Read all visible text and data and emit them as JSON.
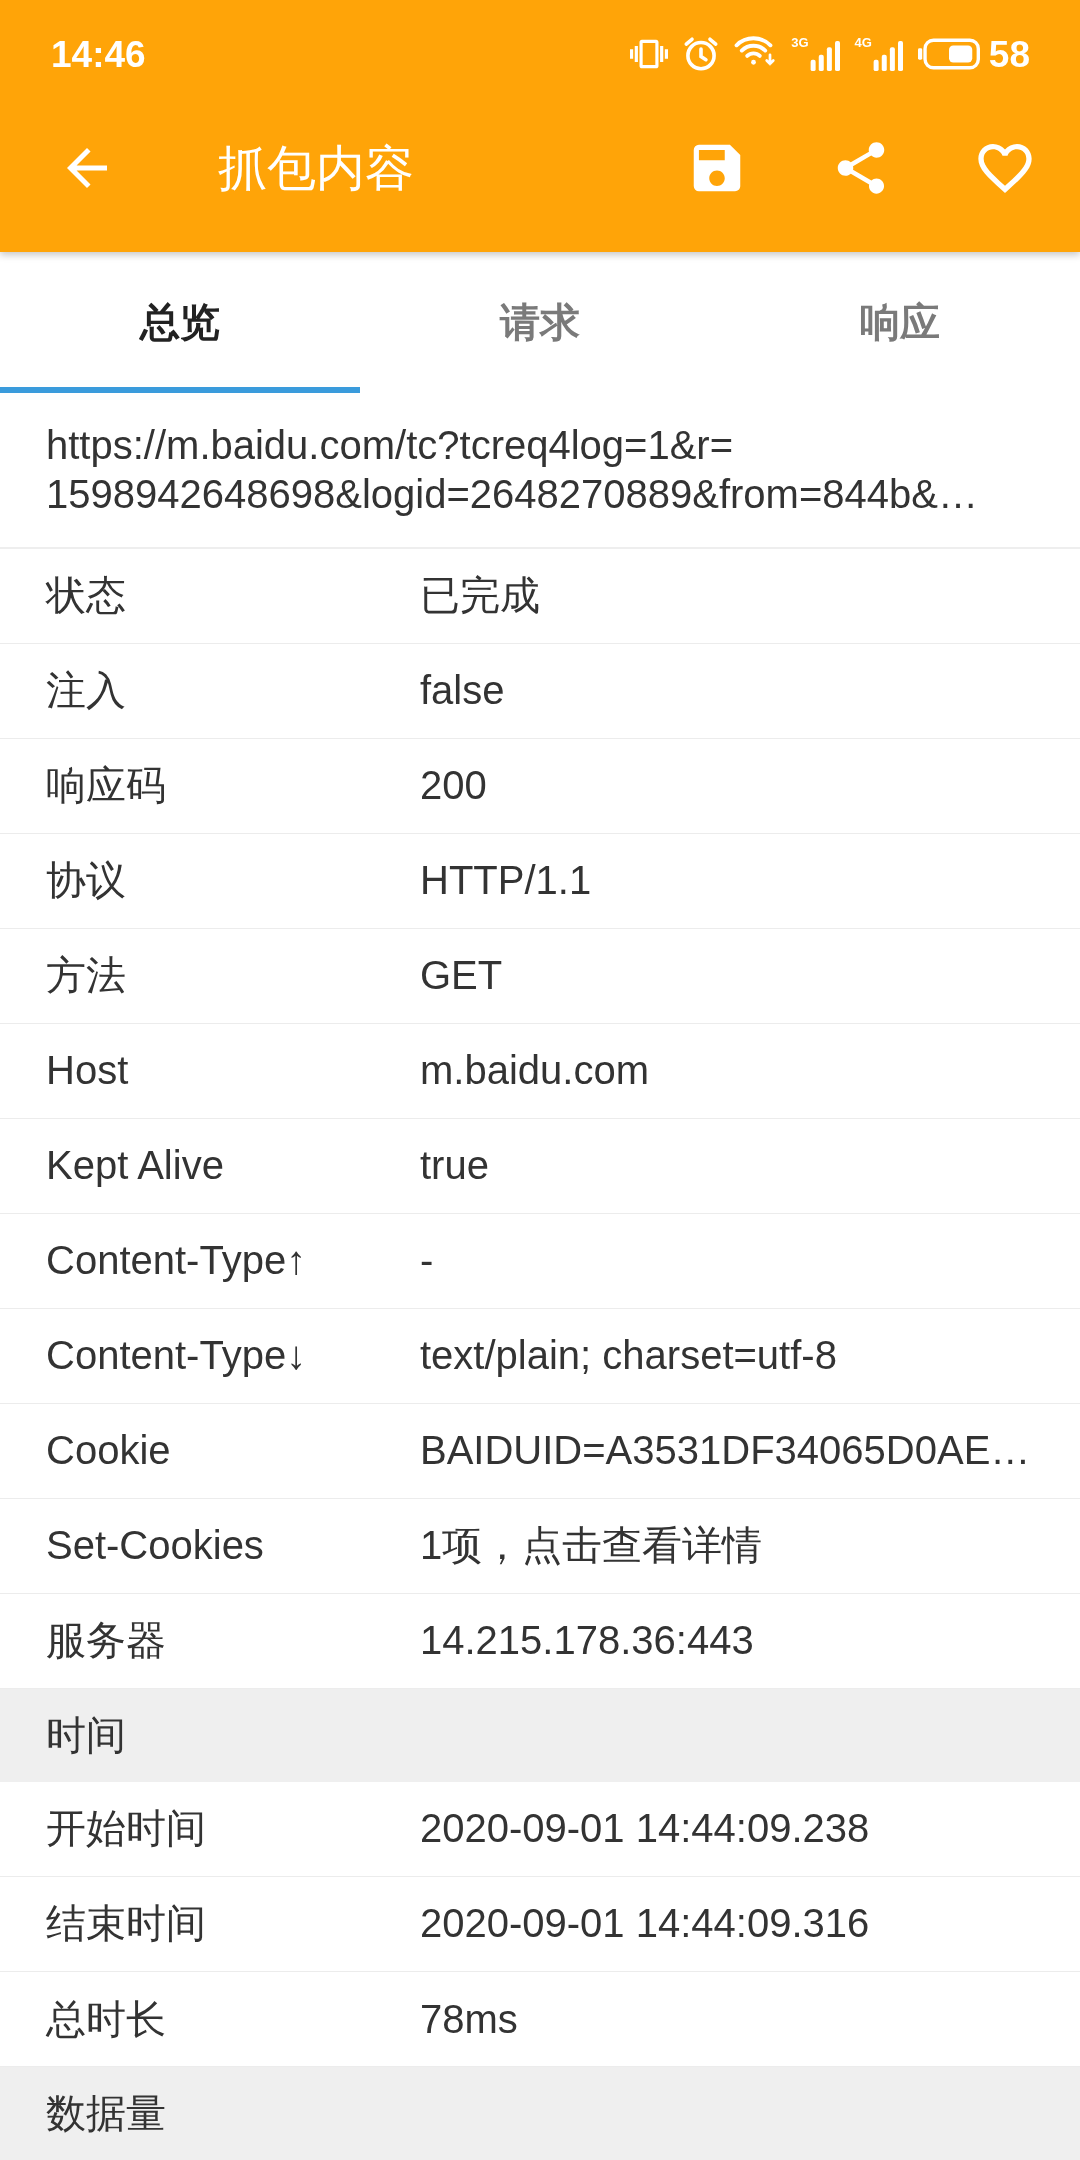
{
  "status_bar": {
    "time": "14:46",
    "networks": [
      {
        "label": "3G"
      },
      {
        "label": "4G"
      }
    ],
    "battery": "58"
  },
  "toolbar": {
    "title": "抓包内容"
  },
  "tabs": [
    {
      "label": "总览",
      "selected": true
    },
    {
      "label": "请求",
      "selected": false
    },
    {
      "label": "响应",
      "selected": false
    }
  ],
  "url": "https://m.baidu.com/tc?tcreq4log=1&r=\n1598942648698&logid=2648270889&from=844b&…",
  "fields": [
    {
      "label": "状态",
      "value": "已完成"
    },
    {
      "label": "注入",
      "value": "false"
    },
    {
      "label": "响应码",
      "value": "200"
    },
    {
      "label": "协议",
      "value": "HTTP/1.1"
    },
    {
      "label": "方法",
      "value": "GET"
    },
    {
      "label": "Host",
      "value": "m.baidu.com"
    },
    {
      "label": "Kept Alive",
      "value": "true"
    },
    {
      "label": "Content-Type↑",
      "value": "-"
    },
    {
      "label": "Content-Type↓",
      "value": "text/plain; charset=utf-8"
    },
    {
      "label": "Cookie",
      "value": "BAIDUID=A3531DF34065D0AE…"
    },
    {
      "label": "Set-Cookies",
      "value": "1项，点击查看详情"
    },
    {
      "label": "服务器",
      "value": "14.215.178.36:443"
    }
  ],
  "sections": [
    {
      "title": "时间",
      "rows": [
        {
          "label": "开始时间",
          "value": "2020-09-01 14:44:09.238"
        },
        {
          "label": "结束时间",
          "value": "2020-09-01 14:44:09.316"
        },
        {
          "label": "总时长",
          "value": "78ms"
        }
      ]
    },
    {
      "title": "数据量"
    }
  ]
}
